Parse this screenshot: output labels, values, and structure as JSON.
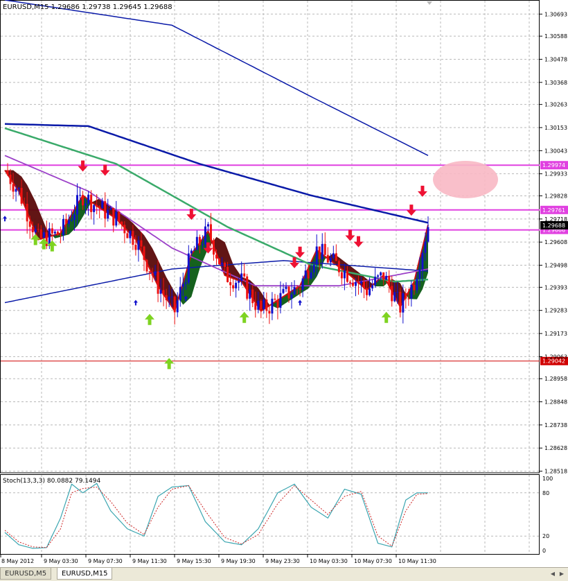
{
  "chart_header": "EURUSD,M15  1.29686 1.29738 1.29645 1.29688",
  "stoch_label": "Stoch(13,3,3) 80.0882 79.1494",
  "price_axis": {
    "min": 1.2851,
    "max": 1.3076,
    "ticks": [
      "1.30693",
      "1.30588",
      "1.30478",
      "1.30368",
      "1.30263",
      "1.30153",
      "1.30043",
      "1.29933",
      "1.29828",
      "1.29718",
      "1.29608",
      "1.29498",
      "1.29393",
      "1.29283",
      "1.29173",
      "1.29063",
      "1.28958",
      "1.28848",
      "1.28738",
      "1.28628",
      "1.28518"
    ]
  },
  "stoch_axis": {
    "min": 0,
    "max": 100,
    "ticks": [
      "100",
      "80",
      "20",
      "0"
    ]
  },
  "level_labels": [
    {
      "id": "lvl-1",
      "value": 1.29974,
      "text": "1.29974",
      "color": "#e040e0"
    },
    {
      "id": "lvl-2",
      "value": 1.29761,
      "text": "1.29761",
      "color": "#e040e0"
    },
    {
      "id": "lvl-3",
      "value": 1.29666,
      "text": "1.29666",
      "color": "#e040e0"
    },
    {
      "id": "lvl-4",
      "value": 1.29042,
      "text": "1.29042",
      "color": "#d00000"
    },
    {
      "id": "bid",
      "value": 1.29688,
      "text": "1.29688",
      "color": "#000000"
    }
  ],
  "time_labels": [
    "8 May 2012",
    "9 May 03:30",
    "9 May 07:30",
    "9 May 11:30",
    "9 May 15:30",
    "9 May 19:30",
    "9 May 23:30",
    "10 May 03:30",
    "10 May 07:30",
    "10 May 11:30"
  ],
  "tabs": [
    {
      "label": "EURUSD,M5",
      "active": false
    },
    {
      "label": "EURUSD,M15",
      "active": true
    }
  ],
  "colors": {
    "bull": "#1010cc",
    "bear": "#ee1111",
    "grid": "#b8b8b8",
    "upper_ma": "#0a1aa8",
    "green_ma": "#3aaa6a",
    "purple_ma": "#9b40c8",
    "ribbon_green": "#0a5a12",
    "ribbon_red": "#5a0808",
    "level": "#e040e0",
    "up_arrow": "#7ed321",
    "down_arrow": "#ee1133",
    "stoch_main": "#3aa5b0",
    "stoch_signal": "#cc2222"
  },
  "chart_data": [
    {
      "type": "candlestick",
      "title": "EURUSD,M15",
      "x_categories": [
        "8 May 2012",
        "9 May 03:30",
        "9 May 07:30",
        "9 May 11:30",
        "9 May 15:30",
        "9 May 19:30",
        "9 May 23:30",
        "10 May 03:30",
        "10 May 07:30",
        "10 May 11:30"
      ],
      "close_path": [
        [
          0,
          1.2995
        ],
        [
          5,
          1.2985
        ],
        [
          12,
          1.2962
        ],
        [
          20,
          1.2965
        ],
        [
          28,
          1.2983
        ],
        [
          33,
          1.2978
        ],
        [
          40,
          1.2972
        ],
        [
          47,
          1.2962
        ],
        [
          55,
          1.294
        ],
        [
          61,
          1.2928
        ],
        [
          67,
          1.2955
        ],
        [
          73,
          1.2966
        ],
        [
          79,
          1.2945
        ],
        [
          85,
          1.2942
        ],
        [
          92,
          1.2928
        ],
        [
          99,
          1.2934
        ],
        [
          106,
          1.294
        ],
        [
          112,
          1.2957
        ],
        [
          118,
          1.2951
        ],
        [
          124,
          1.2945
        ],
        [
          130,
          1.2938
        ],
        [
          136,
          1.2945
        ],
        [
          142,
          1.293
        ],
        [
          147,
          1.2942
        ],
        [
          152,
          1.2969
        ]
      ],
      "horizontal_levels": [
        1.29974,
        1.29761,
        1.29666,
        1.29042
      ],
      "upper_band": [
        [
          0,
          1.3076
        ],
        [
          60,
          1.3064
        ],
        [
          110,
          1.303
        ],
        [
          152,
          1.3002
        ]
      ],
      "middle_band": [
        [
          0,
          1.3017
        ],
        [
          30,
          1.3016
        ],
        [
          70,
          1.2998
        ],
        [
          110,
          1.2983
        ],
        [
          152,
          1.297
        ]
      ],
      "lower_band": [
        [
          0,
          1.2932
        ],
        [
          60,
          1.2948
        ],
        [
          100,
          1.2952
        ],
        [
          152,
          1.2947
        ]
      ],
      "green_ma": [
        [
          0,
          1.3015
        ],
        [
          40,
          1.2998
        ],
        [
          80,
          1.2968
        ],
        [
          110,
          1.295
        ],
        [
          140,
          1.2942
        ],
        [
          152,
          1.2943
        ]
      ],
      "purple_ma": [
        [
          0,
          1.3002
        ],
        [
          30,
          1.2985
        ],
        [
          60,
          1.2958
        ],
        [
          90,
          1.294
        ],
        [
          120,
          1.294
        ],
        [
          152,
          1.2948
        ]
      ],
      "up_arrows": [
        [
          11,
          1.2962
        ],
        [
          14,
          1.296
        ],
        [
          17,
          1.2959
        ],
        [
          52,
          1.2924
        ],
        [
          59,
          1.2903
        ],
        [
          86,
          1.2925
        ],
        [
          137,
          1.2925
        ]
      ],
      "down_arrows": [
        [
          28,
          1.2997
        ],
        [
          36,
          1.2995
        ],
        [
          67,
          1.2974
        ],
        [
          73,
          1.2958
        ],
        [
          104,
          1.2951
        ],
        [
          106,
          1.2956
        ],
        [
          124,
          1.2964
        ],
        [
          127,
          1.2961
        ],
        [
          146,
          1.2976
        ],
        [
          150,
          1.2985
        ]
      ]
    },
    {
      "type": "line",
      "title": "Stoch(13,3,3) 80.0882 79.1494",
      "ylim": [
        0,
        100
      ],
      "series": [
        {
          "name": "main",
          "points": [
            [
              0,
              25
            ],
            [
              5,
              8
            ],
            [
              10,
              3
            ],
            [
              15,
              4
            ],
            [
              20,
              45
            ],
            [
              24,
              92
            ],
            [
              28,
              80
            ],
            [
              33,
              93
            ],
            [
              38,
              55
            ],
            [
              44,
              30
            ],
            [
              50,
              20
            ],
            [
              55,
              75
            ],
            [
              60,
              88
            ],
            [
              66,
              90
            ],
            [
              72,
              40
            ],
            [
              79,
              12
            ],
            [
              85,
              8
            ],
            [
              91,
              30
            ],
            [
              98,
              80
            ],
            [
              104,
              92
            ],
            [
              110,
              60
            ],
            [
              116,
              45
            ],
            [
              122,
              85
            ],
            [
              128,
              78
            ],
            [
              134,
              10
            ],
            [
              139,
              5
            ],
            [
              144,
              70
            ],
            [
              148,
              80
            ],
            [
              152,
              80
            ]
          ]
        },
        {
          "name": "signal",
          "points": [
            [
              0,
              28
            ],
            [
              5,
              12
            ],
            [
              10,
              5
            ],
            [
              15,
              4
            ],
            [
              20,
              30
            ],
            [
              24,
              80
            ],
            [
              28,
              86
            ],
            [
              33,
              88
            ],
            [
              38,
              68
            ],
            [
              44,
              38
            ],
            [
              50,
              22
            ],
            [
              55,
              60
            ],
            [
              60,
              85
            ],
            [
              66,
              90
            ],
            [
              72,
              55
            ],
            [
              79,
              18
            ],
            [
              85,
              9
            ],
            [
              91,
              22
            ],
            [
              98,
              65
            ],
            [
              104,
              90
            ],
            [
              110,
              70
            ],
            [
              116,
              50
            ],
            [
              122,
              75
            ],
            [
              128,
              82
            ],
            [
              134,
              20
            ],
            [
              139,
              6
            ],
            [
              144,
              55
            ],
            [
              148,
              78
            ],
            [
              152,
              79
            ]
          ]
        }
      ]
    }
  ]
}
